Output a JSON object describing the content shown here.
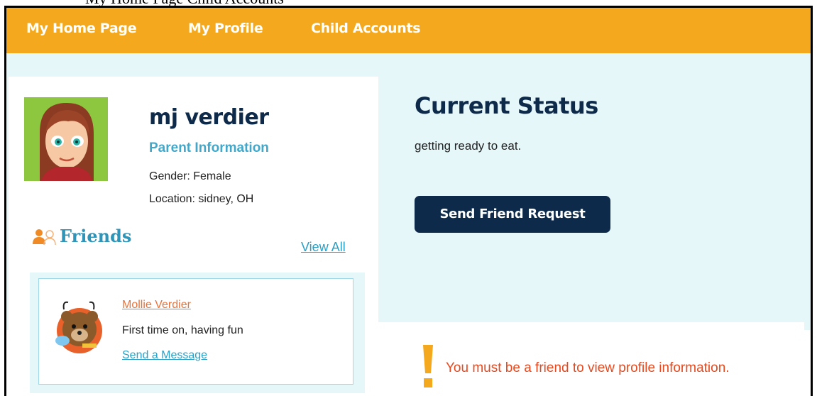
{
  "page_caption": "My Home Page Child Accounts",
  "nav": {
    "items": [
      {
        "label": "My Home Page"
      },
      {
        "label": "My Profile"
      },
      {
        "label": "Child Accounts"
      }
    ]
  },
  "profile": {
    "name": "mj verdier",
    "parent_info_label": "Parent Information",
    "gender": "Gender: Female",
    "location": "Location: sidney, OH"
  },
  "friends": {
    "title": "Friends",
    "view_all": "View All",
    "list": [
      {
        "name": "Mollie Verdier",
        "status": "First time on, having fun",
        "message_link": "Send a Message"
      }
    ]
  },
  "status": {
    "title": "Current Status",
    "text": "getting ready to eat.",
    "button": "Send Friend Request"
  },
  "notice": {
    "text": "You must be a friend to view profile information."
  },
  "colors": {
    "nav_bg": "#f4a81d",
    "accent_light": "#e6f7fa",
    "navy": "#0d2a4a",
    "link_blue": "#2aa0c6",
    "orange_text": "#e8491e"
  }
}
